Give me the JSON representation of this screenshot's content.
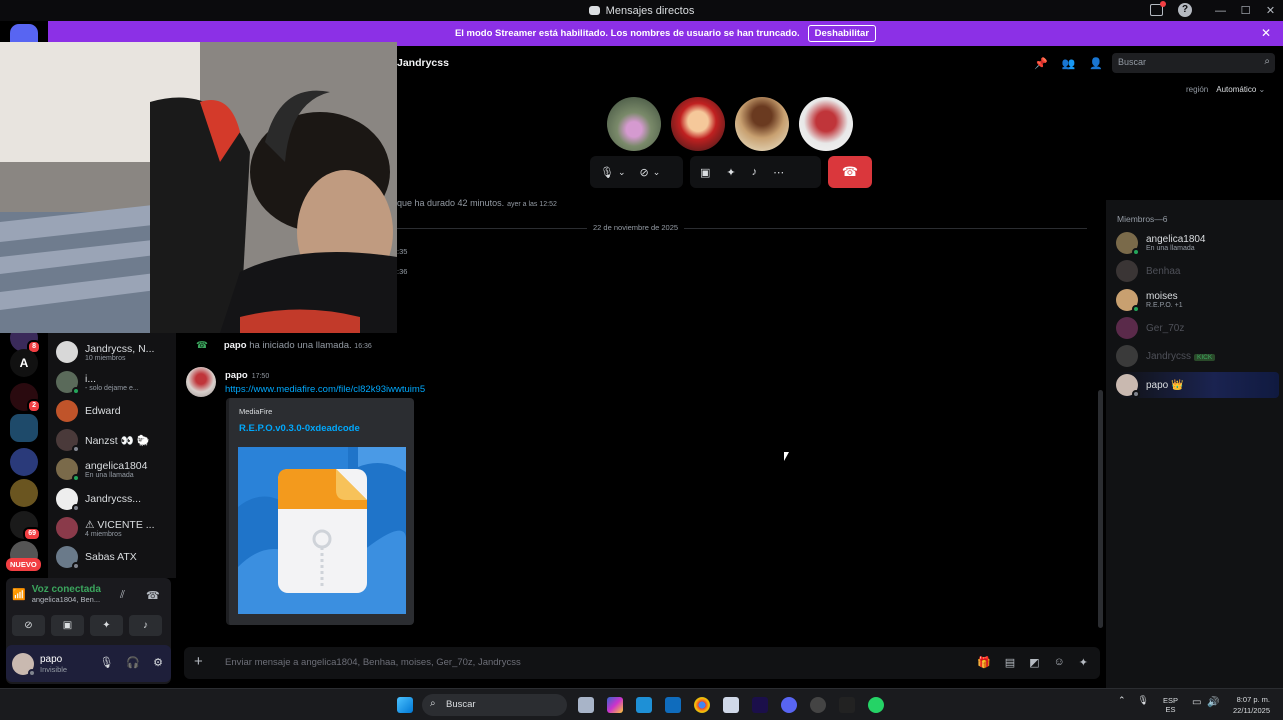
{
  "window": {
    "title": "Mensajes directos",
    "controls": [
      "—",
      "☐",
      "✕"
    ]
  },
  "banner": {
    "text": "El modo Streamer está habilitado. Los nombres de usuario se han truncado.",
    "button": "Deshabilitar"
  },
  "rail": {
    "badges": [
      "8",
      "2",
      "69"
    ],
    "letter": "A",
    "nuevo": "NUEVO"
  },
  "header": {
    "title": "Jandrycss",
    "search_placeholder": "Buscar",
    "region_label": "región",
    "region_value": "Automático"
  },
  "call": {
    "participants": [
      "user-1",
      "user-2",
      "user-3",
      "user-4"
    ]
  },
  "chat": {
    "ended_text": "que ha durado 42 minutos.",
    "ended_time": "ayer a las 12:52",
    "date_divider": "22 de noviembre de 2025",
    "ts1": ":35",
    "ts2": ":36",
    "call_start_author": "papo",
    "call_start_text": "ha iniciado una llamada.",
    "call_start_time": "16:36",
    "message": {
      "author": "papo",
      "time": "17:50",
      "link": "https://www.mediafire.com/file/cl82k93iwwtuim5"
    },
    "embed": {
      "provider": "MediaFire",
      "title": "R.E.P.O.v0.3.0-0xdeadcode"
    },
    "composer_placeholder": "Enviar mensaje a angelica1804, Benhaa, moises, Ger_70z, Jandrycss"
  },
  "dms": [
    {
      "name": "Jandrycss, N...",
      "sub": "10 miembros"
    },
    {
      "name": "i...",
      "sub": "- solo dejame e..."
    },
    {
      "name": "Edward",
      "sub": ""
    },
    {
      "name": "Nanzst 👀 🐑",
      "sub": ""
    },
    {
      "name": "angelica1804",
      "sub": "En una llamada"
    },
    {
      "name": "Jandrycss...",
      "sub": ""
    },
    {
      "name": "⚠ VICENTE ...",
      "sub": "4 miembros"
    },
    {
      "name": "Sabas ATX",
      "sub": ""
    }
  ],
  "voice": {
    "title": "Voz conectada",
    "sub": "angelica1804, Ben..."
  },
  "user": {
    "name": "papo",
    "status": "Invisible"
  },
  "members": {
    "header": "Miembros—6",
    "list": [
      {
        "name": "angelica1804",
        "sub": "En una llamada",
        "offline": false
      },
      {
        "name": "Benhaa",
        "sub": "",
        "offline": true
      },
      {
        "name": "moises",
        "sub": "R.E.P.O. +1",
        "offline": false
      },
      {
        "name": "Ger_70z",
        "sub": "",
        "offline": true
      },
      {
        "name": "Jandrycss",
        "sub": "",
        "offline": true,
        "tag": "KICK"
      },
      {
        "name": "papo 👑",
        "sub": "",
        "offline": false
      }
    ]
  },
  "taskbar": {
    "search": "Buscar",
    "lang_1": "ESP",
    "lang_2": "ES",
    "time": "8:07 p. m.",
    "date": "22/11/2025"
  }
}
